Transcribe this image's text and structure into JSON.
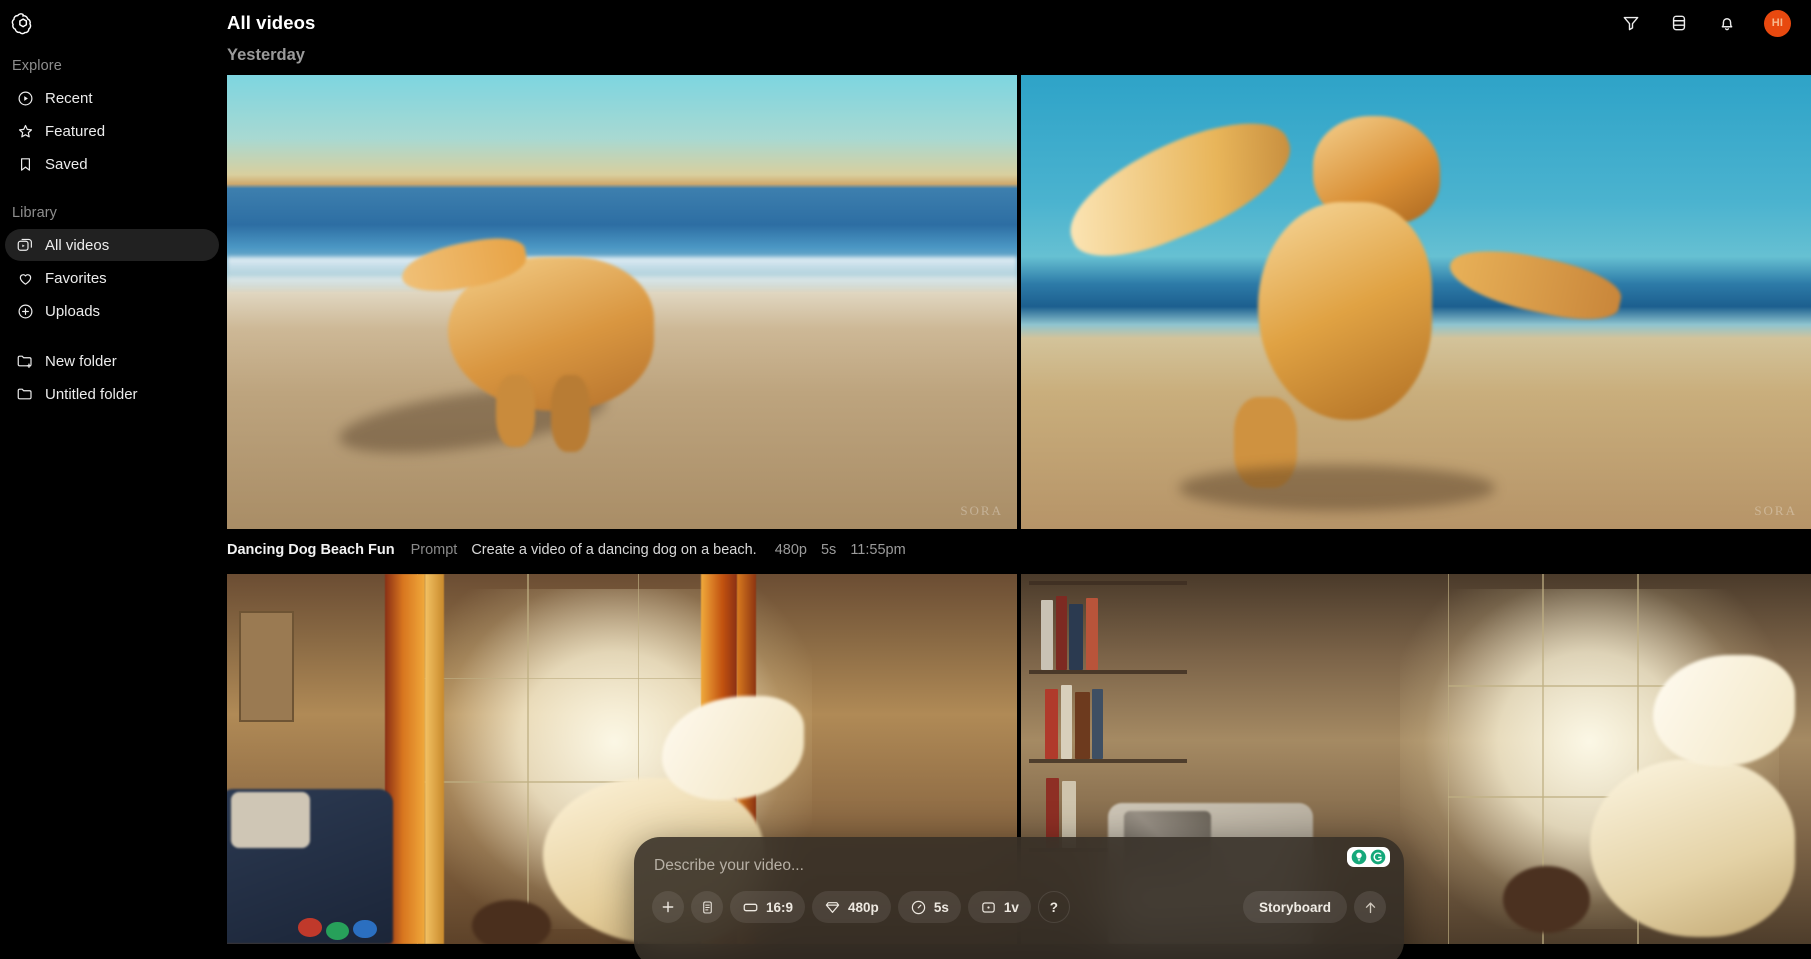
{
  "brand": {
    "logo_name": "sora-logo",
    "accent": "#e8490f"
  },
  "sidebar": {
    "sections": [
      {
        "label": "Explore",
        "items": [
          {
            "label": "Recent",
            "icon": "play-circle-icon",
            "active": false
          },
          {
            "label": "Featured",
            "icon": "star-icon",
            "active": false
          },
          {
            "label": "Saved",
            "icon": "bookmark-icon",
            "active": false
          }
        ]
      },
      {
        "label": "Library",
        "items": [
          {
            "label": "All videos",
            "icon": "video-library-icon",
            "active": true
          },
          {
            "label": "Favorites",
            "icon": "heart-icon",
            "active": false
          },
          {
            "label": "Uploads",
            "icon": "plus-circle-icon",
            "active": false
          }
        ]
      },
      {
        "label": "",
        "items": [
          {
            "label": "New folder",
            "icon": "folder-plus-icon",
            "active": false
          },
          {
            "label": "Untitled folder",
            "icon": "folder-icon",
            "active": false
          }
        ]
      }
    ]
  },
  "header": {
    "title": "All videos",
    "actions": [
      {
        "name": "filter-icon",
        "label": "Filter"
      },
      {
        "name": "layout-toggle-icon",
        "label": "Layout"
      },
      {
        "name": "bell-icon",
        "label": "Notifications"
      }
    ],
    "avatar_initials": "HI"
  },
  "main": {
    "date_heading": "Yesterday",
    "videos": [
      {
        "title": "Dancing Dog Beach Fun",
        "prompt_label": "Prompt",
        "prompt": "Create a video of a dancing dog on a beach.",
        "resolution": "480p",
        "duration": "5s",
        "time": "11:55pm",
        "watermark": "SORA"
      }
    ]
  },
  "prompt_bar": {
    "placeholder": "Describe your video...",
    "value": "",
    "tools": [
      {
        "name": "add-attachment-button",
        "icon": "plus-icon",
        "label": ""
      },
      {
        "name": "preset-button",
        "icon": "card-list-icon",
        "label": ""
      },
      {
        "name": "aspect-ratio-button",
        "icon": "rectangle-icon",
        "label": "16:9"
      },
      {
        "name": "resolution-button",
        "icon": "diamond-icon",
        "label": "480p"
      },
      {
        "name": "duration-button",
        "icon": "clock-icon",
        "label": "5s"
      },
      {
        "name": "variations-button",
        "icon": "frame-dot-icon",
        "label": "1v"
      },
      {
        "name": "help-button",
        "icon": "question-icon",
        "label": "?"
      }
    ],
    "storyboard_label": "Storyboard",
    "send_icon": "arrow-up-icon",
    "grammarly": {
      "name": "grammarly-widget",
      "icons": [
        "lightbulb-icon",
        "grammarly-g-icon"
      ]
    }
  }
}
